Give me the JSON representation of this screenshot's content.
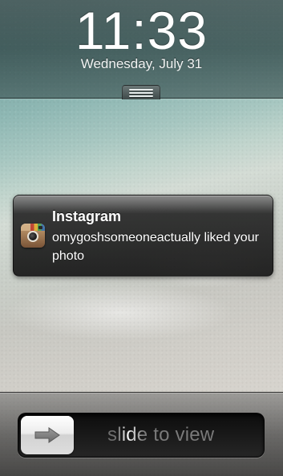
{
  "lock_screen": {
    "time": "11:33",
    "date": "Wednesday, July 31"
  },
  "notification": {
    "app_name": "Instagram",
    "message": "omygoshsomeoneactually liked your photo",
    "icon": "instagram-app-icon"
  },
  "unlock_slider": {
    "label": "slide to view",
    "knob_icon": "arrow-right-icon"
  },
  "colors": {
    "notification_bg": "#1a1a1a",
    "text_white": "#ffffff",
    "slider_text": "#8a8a8a"
  }
}
